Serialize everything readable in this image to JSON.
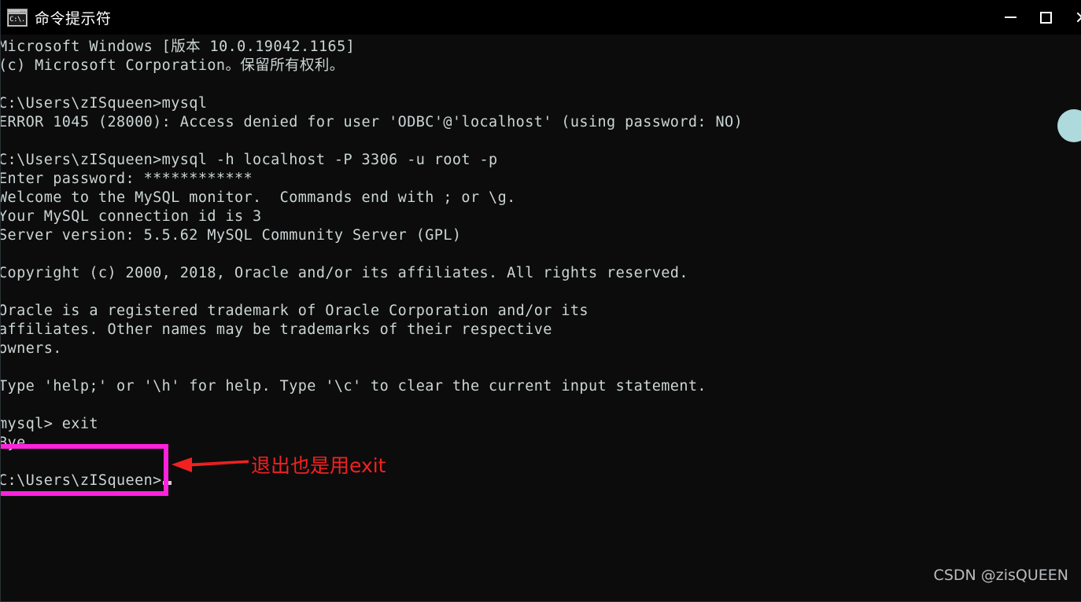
{
  "window": {
    "title": "命令提示符",
    "icon": "cmd-prompt-icon",
    "icon_label": "C:\\.",
    "background_color": "#0c0c0c",
    "controls": {
      "minimize_label": "—",
      "maximize_label": "□",
      "close_label": "✕"
    }
  },
  "terminal": {
    "text_color": "#ccd5d5",
    "lines": [
      "Microsoft Windows [版本 10.0.19042.1165]",
      "(c) Microsoft Corporation。保留所有权利。",
      "",
      "C:\\Users\\zISqueen>mysql",
      "ERROR 1045 (28000): Access denied for user 'ODBC'@'localhost' (using password: NO)",
      "",
      "C:\\Users\\zISqueen>mysql -h localhost -P 3306 -u root -p",
      "Enter password: ************",
      "Welcome to the MySQL monitor.  Commands end with ; or \\g.",
      "Your MySQL connection id is 3",
      "Server version: 5.5.62 MySQL Community Server (GPL)",
      "",
      "Copyright (c) 2000, 2018, Oracle and/or its affiliates. All rights reserved.",
      "",
      "Oracle is a registered trademark of Oracle Corporation and/or its",
      "affiliates. Other names may be trademarks of their respective",
      "owners.",
      "",
      "Type 'help;' or '\\h' for help. Type '\\c' to clear the current input statement.",
      "",
      "mysql> exit",
      "Bye",
      ""
    ],
    "prompt_line": "C:\\Users\\zISqueen>",
    "cursor": "block"
  },
  "annotations": {
    "highlight_box": {
      "color": "#ff22dd",
      "encloses": [
        "mysql> exit",
        "Bye"
      ]
    },
    "arrow": {
      "color": "#f22121",
      "direction": "left"
    },
    "note_text": "退出也是用exit",
    "note_color": "#f22121"
  },
  "watermark": {
    "text": "CSDN @zisQUEEN",
    "color": "#b9bdbf"
  },
  "decoration": {
    "circle_color": "#aed9dd"
  }
}
